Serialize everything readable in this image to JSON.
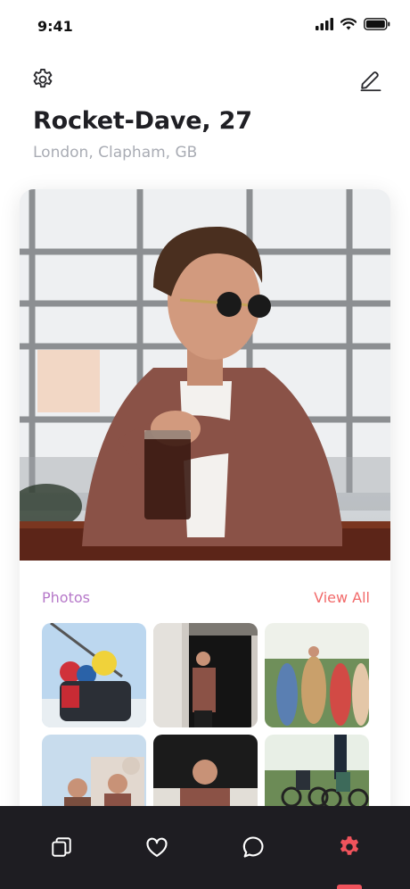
{
  "status_bar": {
    "time": "9:41"
  },
  "header": {
    "name": "Rocket-Dave, 27",
    "location": "London, Clapham, GB"
  },
  "photos_section": {
    "title": "Photos",
    "view_all_label": "View All"
  },
  "icons": {
    "settings": "gear-icon",
    "edit": "pencil-icon",
    "tab_cards": "cards-icon",
    "tab_likes": "heart-icon",
    "tab_chat": "chat-bubble-icon",
    "tab_settings": "gear-icon"
  },
  "colors": {
    "accent_purple": "#b678c9",
    "accent_red": "#f26a6a",
    "tab_active": "#f0535c",
    "tab_bar_bg": "#1e1d22"
  }
}
